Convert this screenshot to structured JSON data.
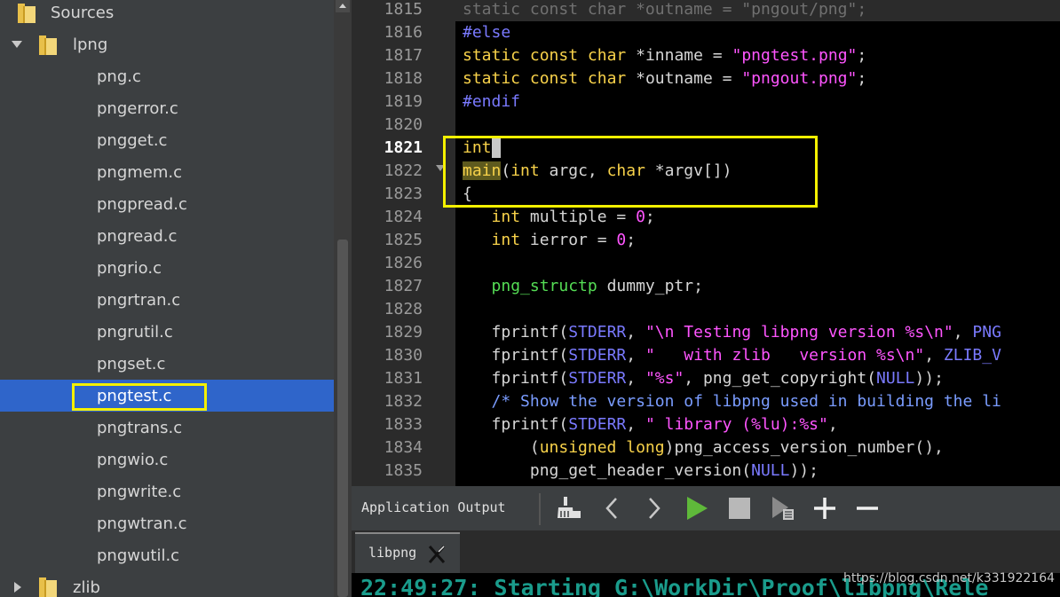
{
  "sidebar": {
    "root_label": "Sources",
    "folder_label": "lpng",
    "files": [
      "png.c",
      "pngerror.c",
      "pngget.c",
      "pngmem.c",
      "pngpread.c",
      "pngread.c",
      "pngrio.c",
      "pngrtran.c",
      "pngrutil.c",
      "pngset.c",
      "pngtest.c",
      "pngtrans.c",
      "pngwio.c",
      "pngwrite.c",
      "pngwtran.c",
      "pngwutil.c"
    ],
    "selected_file": "pngtest.c",
    "next_folder_label": "zlib"
  },
  "editor": {
    "current_line": "1821",
    "lines": [
      {
        "num": "1815",
        "text": "static const char *outname = \"pngout/png\";"
      },
      {
        "num": "1816",
        "text": "#else"
      },
      {
        "num": "1817",
        "text": "static const char *inname = \"pngtest.png\";"
      },
      {
        "num": "1818",
        "text": "static const char *outname = \"pngout.png\";"
      },
      {
        "num": "1819",
        "text": "#endif"
      },
      {
        "num": "1820",
        "text": ""
      },
      {
        "num": "1821",
        "text": "int"
      },
      {
        "num": "1822",
        "text": "main(int argc, char *argv[])"
      },
      {
        "num": "1823",
        "text": "{"
      },
      {
        "num": "1824",
        "text": "   int multiple = 0;"
      },
      {
        "num": "1825",
        "text": "   int ierror = 0;"
      },
      {
        "num": "1826",
        "text": ""
      },
      {
        "num": "1827",
        "text": "   png_structp dummy_ptr;"
      },
      {
        "num": "1828",
        "text": ""
      },
      {
        "num": "1829",
        "text": "   fprintf(STDERR, \"\\n Testing libpng version %s\\n\", PNG"
      },
      {
        "num": "1830",
        "text": "   fprintf(STDERR, \"   with zlib   version %s\\n\", ZLIB_V"
      },
      {
        "num": "1831",
        "text": "   fprintf(STDERR, \"%s\", png_get_copyright(NULL));"
      },
      {
        "num": "1832",
        "text": "   /* Show the version of libpng used in building the li"
      },
      {
        "num": "1833",
        "text": "   fprintf(STDERR, \" library (%lu):%s\","
      },
      {
        "num": "1834",
        "text": "       (unsigned long)png_access_version_number(),"
      },
      {
        "num": "1835",
        "text": "       png_get_header_version(NULL));"
      }
    ]
  },
  "output_panel": {
    "title": "Application Output",
    "tab_label": "libpng",
    "output_line": "22:49:27: Starting G:\\WorkDir\\Proof\\libpng\\Rele",
    "icons": [
      "clear-output-icon",
      "previous-icon",
      "next-icon",
      "run-icon",
      "stop-icon",
      "attach-debugger-icon",
      "zoom-in-icon",
      "zoom-out-icon"
    ]
  },
  "watermark": "https://blog.csdn.net/k331922164",
  "colors": {
    "selection": "#2f65ca",
    "annotation_box": "#f4f000",
    "keyword": "#f8d24a",
    "string": "#ff55ff",
    "preprocessor": "#7a7aff",
    "type": "#55dd55"
  }
}
